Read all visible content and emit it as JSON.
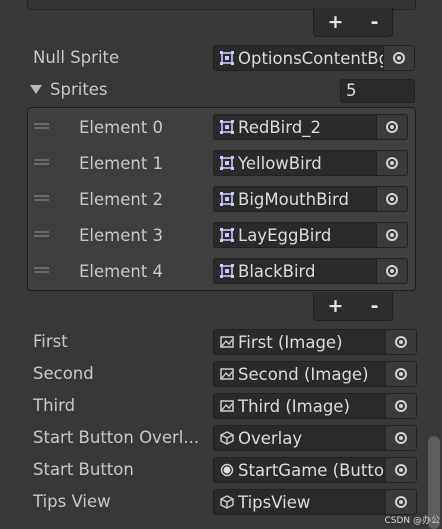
{
  "top_list": {
    "add_label": "+",
    "remove_label": "-"
  },
  "null_sprite": {
    "label": "Null Sprite",
    "value": "OptionsContentBg",
    "icon": "sprite-icon"
  },
  "sprites": {
    "label": "Sprites",
    "size": "5",
    "elements": [
      {
        "label": "Element 0",
        "value": "RedBird_2",
        "icon": "sprite-icon"
      },
      {
        "label": "Element 1",
        "value": "YellowBird",
        "icon": "sprite-icon"
      },
      {
        "label": "Element 2",
        "value": "BigMouthBird",
        "icon": "sprite-icon"
      },
      {
        "label": "Element 3",
        "value": "LayEggBird",
        "icon": "sprite-icon"
      },
      {
        "label": "Element 4",
        "value": "BlackBird",
        "icon": "sprite-icon"
      }
    ],
    "add_label": "+",
    "remove_label": "-"
  },
  "fields": [
    {
      "label": "First",
      "value": "First (Image)",
      "icon": "image-icon"
    },
    {
      "label": "Second",
      "value": "Second (Image)",
      "icon": "image-icon"
    },
    {
      "label": "Third",
      "value": "Third (Image)",
      "icon": "image-icon"
    },
    {
      "label": "Start Button Overl...",
      "value": "Overlay",
      "icon": "gameobject-icon"
    },
    {
      "label": "Start Button",
      "value": "StartGame (Button)",
      "icon": "button-icon"
    },
    {
      "label": "Tips View",
      "value": "TipsView",
      "icon": "gameobject-icon"
    }
  ],
  "watermark": "CSDN @办公"
}
